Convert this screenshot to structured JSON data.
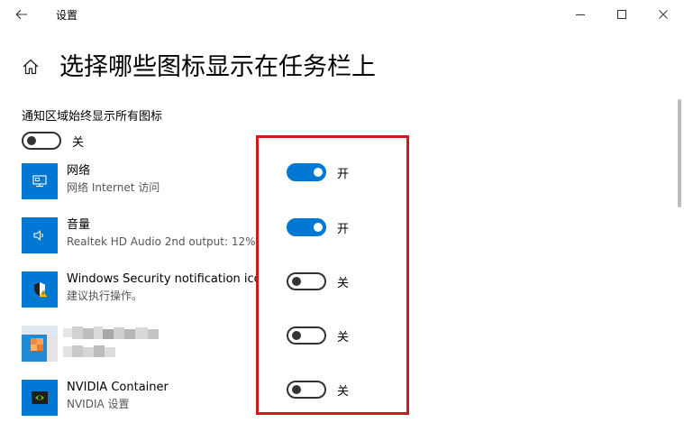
{
  "window": {
    "title": "设置",
    "back_icon": "back-arrow-icon",
    "minimize_icon": "minimize-icon",
    "maximize_icon": "maximize-icon",
    "close_icon": "close-icon"
  },
  "page": {
    "home_icon": "home-icon",
    "title": "选择哪些图标显示在任务栏上"
  },
  "always_show": {
    "label": "通知区域始终显示所有图标",
    "state": "关",
    "on": false
  },
  "apps": [
    {
      "name": "网络",
      "subtitle": "网络 Internet 访问",
      "icon": "network-icon",
      "state": "开",
      "on": true
    },
    {
      "name": "音量",
      "subtitle": "Realtek HD Audio 2nd output: 12%",
      "icon": "volume-icon",
      "state": "开",
      "on": true
    },
    {
      "name": "Windows Security notification icon",
      "subtitle": "建议执行操作。",
      "icon": "security-shield-icon",
      "state": "关",
      "on": false
    },
    {
      "name": "",
      "subtitle": "",
      "icon": "blurred-app-icon",
      "state": "关",
      "on": false
    },
    {
      "name": "NVIDIA Container",
      "subtitle": "NVIDIA 设置",
      "icon": "nvidia-icon",
      "state": "关",
      "on": false
    }
  ],
  "colors": {
    "accent": "#0078d4",
    "highlight_border": "#d0191e",
    "toggle_off": "#333333"
  }
}
